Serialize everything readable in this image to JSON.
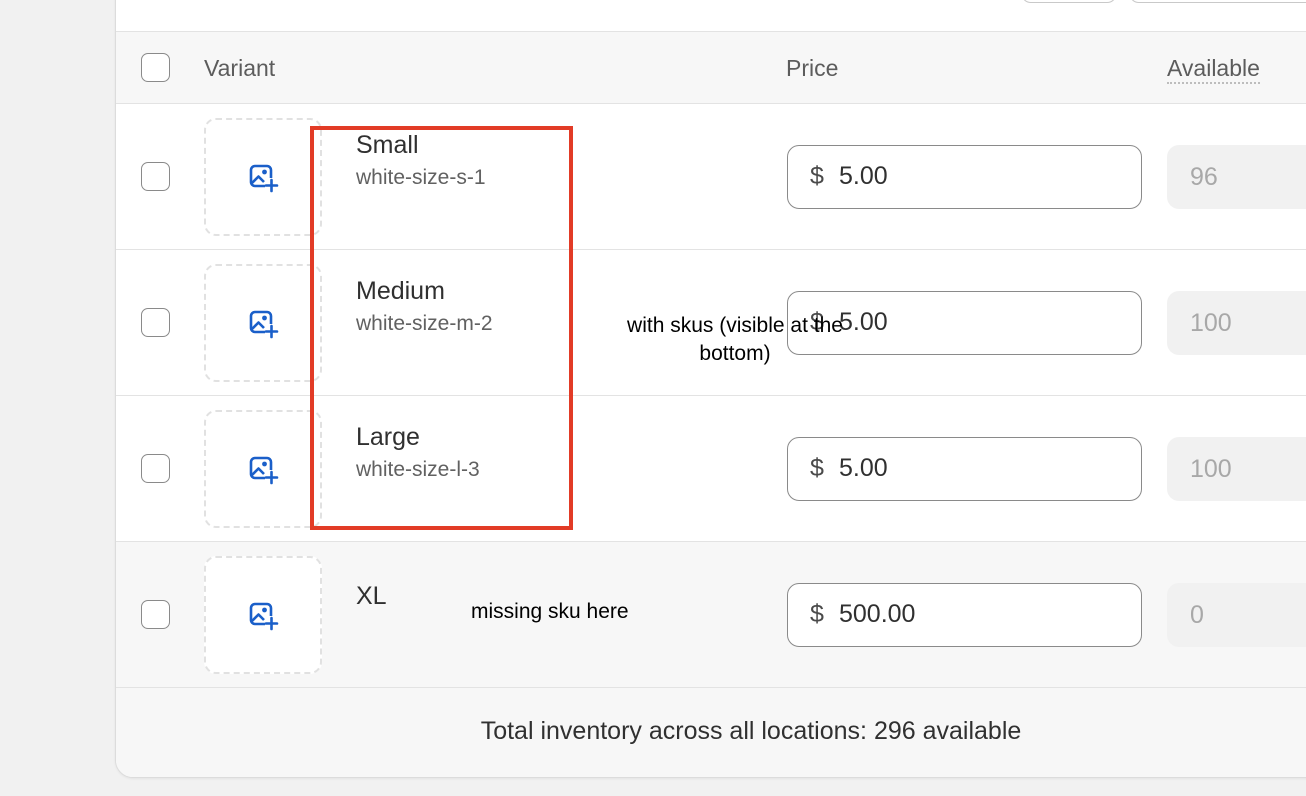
{
  "table": {
    "headers": {
      "variant": "Variant",
      "price": "Price",
      "available": "Available"
    },
    "rows": [
      {
        "name": "Small",
        "sku": "white-size-s-1",
        "currency": "$",
        "price": "5.00",
        "available": "96"
      },
      {
        "name": "Medium",
        "sku": "white-size-m-2",
        "currency": "$",
        "price": "5.00",
        "available": "100"
      },
      {
        "name": "Large",
        "sku": "white-size-l-3",
        "currency": "$",
        "price": "5.00",
        "available": "100"
      },
      {
        "name": "XL",
        "sku": "",
        "currency": "$",
        "price": "500.00",
        "available": "0"
      }
    ],
    "footer": "Total inventory across all locations: 296 available"
  },
  "annotations": {
    "skus_note": "with skus (visible at the bottom)",
    "missing_note": "missing sku here",
    "highlight_color": "#e23b26"
  },
  "icons": {
    "image_placeholder": "image-add-icon"
  }
}
